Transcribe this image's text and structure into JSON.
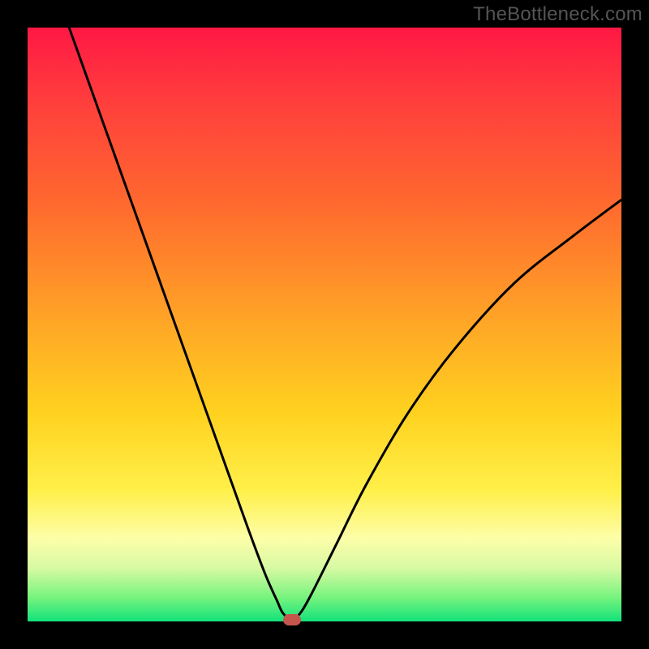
{
  "watermark": "TheBottleneck.com",
  "colors": {
    "frame": "#000000",
    "gradient_top": "#ff1844",
    "gradient_mid": "#ffd21f",
    "gradient_bottom": "#11e27a",
    "curve_stroke": "#000000",
    "marker_fill": "#c4564e"
  },
  "chart_data": {
    "type": "line",
    "title": "",
    "xlabel": "",
    "ylabel": "",
    "xlim": [
      0,
      100
    ],
    "ylim": [
      0,
      100
    ],
    "grid": false,
    "legend": false,
    "series": [
      {
        "name": "bottleneck-curve",
        "x": [
          7,
          12,
          17,
          22,
          27,
          32,
          37,
          40,
          42,
          43,
          44.5,
          46,
          48,
          52,
          57,
          64,
          72,
          82,
          92,
          100
        ],
        "y": [
          100,
          86,
          72,
          58,
          44,
          30,
          16,
          8,
          3.5,
          1.4,
          0.3,
          1.5,
          5,
          13,
          23,
          35,
          46,
          57,
          65,
          71
        ]
      }
    ],
    "annotations": [
      {
        "name": "min-marker",
        "x": 44.5,
        "y": 0.3,
        "shape": "pill"
      }
    ]
  }
}
